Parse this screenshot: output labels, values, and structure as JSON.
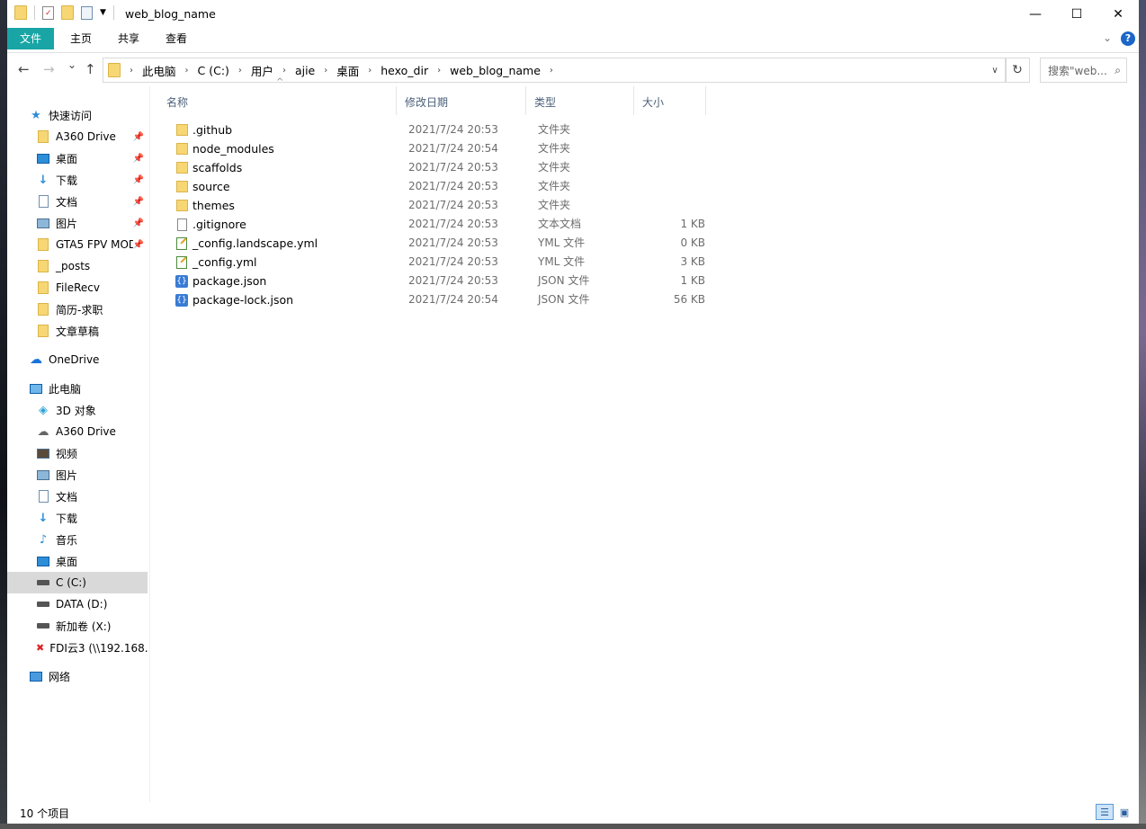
{
  "window": {
    "title": "web_blog_name",
    "controls": {
      "minimize": "—",
      "maximize": "☐",
      "close": "✕"
    }
  },
  "ribbon": {
    "tabs": [
      "文件",
      "主页",
      "共享",
      "查看"
    ],
    "help": "?"
  },
  "navigation": {
    "back": "←",
    "forward": "→",
    "recent": "⌄",
    "up": "↑",
    "breadcrumb": [
      "此电脑",
      "C (C:)",
      "用户",
      "ajie",
      "桌面",
      "hexo_dir",
      "web_blog_name"
    ],
    "search_placeholder": "搜索\"web..."
  },
  "sidebar": {
    "quick_access_label": "快速访问",
    "quick_access_items": [
      {
        "label": "A360 Drive",
        "icon": "folder-icon",
        "pinned": true
      },
      {
        "label": "桌面",
        "icon": "desktop-icon",
        "pinned": true
      },
      {
        "label": "下载",
        "icon": "download-icon",
        "pinned": true
      },
      {
        "label": "文档",
        "icon": "document-icon",
        "pinned": true
      },
      {
        "label": "图片",
        "icon": "pictures-icon",
        "pinned": true
      },
      {
        "label": "GTA5 FPV MOD",
        "icon": "folder-icon",
        "pinned": true
      },
      {
        "label": "_posts",
        "icon": "folder-icon",
        "pinned": false
      },
      {
        "label": "FileRecv",
        "icon": "folder-icon",
        "pinned": false
      },
      {
        "label": "简历-求职",
        "icon": "folder-icon",
        "pinned": false
      },
      {
        "label": "文章草稿",
        "icon": "folder-icon",
        "pinned": false
      }
    ],
    "onedrive_label": "OneDrive",
    "this_pc_label": "此电脑",
    "this_pc_items": [
      {
        "label": "3D 对象",
        "icon": "3d-objects-icon"
      },
      {
        "label": "A360 Drive",
        "icon": "cloud-drive-icon"
      },
      {
        "label": "视频",
        "icon": "video-icon"
      },
      {
        "label": "图片",
        "icon": "pictures-icon"
      },
      {
        "label": "文档",
        "icon": "document-icon"
      },
      {
        "label": "下载",
        "icon": "download-icon"
      },
      {
        "label": "音乐",
        "icon": "music-icon"
      },
      {
        "label": "桌面",
        "icon": "desktop-icon"
      },
      {
        "label": "C (C:)",
        "icon": "drive-icon",
        "selected": true
      },
      {
        "label": "DATA (D:)",
        "icon": "drive-icon"
      },
      {
        "label": "新加卷 (X:)",
        "icon": "drive-icon"
      },
      {
        "label": "FDI云3 (\\\\192.168.",
        "icon": "network-drive-disconnected-icon"
      }
    ],
    "network_label": "网络"
  },
  "columns": {
    "name": "名称",
    "date": "修改日期",
    "type": "类型",
    "size": "大小"
  },
  "files": [
    {
      "name": ".github",
      "date": "2021/7/24 20:53",
      "type": "文件夹",
      "size": "",
      "icon": "folder"
    },
    {
      "name": "node_modules",
      "date": "2021/7/24 20:54",
      "type": "文件夹",
      "size": "",
      "icon": "folder"
    },
    {
      "name": "scaffolds",
      "date": "2021/7/24 20:53",
      "type": "文件夹",
      "size": "",
      "icon": "folder"
    },
    {
      "name": "source",
      "date": "2021/7/24 20:53",
      "type": "文件夹",
      "size": "",
      "icon": "folder"
    },
    {
      "name": "themes",
      "date": "2021/7/24 20:53",
      "type": "文件夹",
      "size": "",
      "icon": "folder"
    },
    {
      "name": ".gitignore",
      "date": "2021/7/24 20:53",
      "type": "文本文档",
      "size": "1 KB",
      "icon": "text"
    },
    {
      "name": "_config.landscape.yml",
      "date": "2021/7/24 20:53",
      "type": "YML 文件",
      "size": "0 KB",
      "icon": "yml"
    },
    {
      "name": "_config.yml",
      "date": "2021/7/24 20:53",
      "type": "YML 文件",
      "size": "3 KB",
      "icon": "yml"
    },
    {
      "name": "package.json",
      "date": "2021/7/24 20:53",
      "type": "JSON 文件",
      "size": "1 KB",
      "icon": "json"
    },
    {
      "name": "package-lock.json",
      "date": "2021/7/24 20:54",
      "type": "JSON 文件",
      "size": "56 KB",
      "icon": "json"
    }
  ],
  "status": {
    "item_count": "10 个项目"
  },
  "colors": {
    "file_tab": "#19a5a5",
    "selection": "#d9d9d9",
    "folder": "#f7d774",
    "header_text": "#4c607a"
  }
}
